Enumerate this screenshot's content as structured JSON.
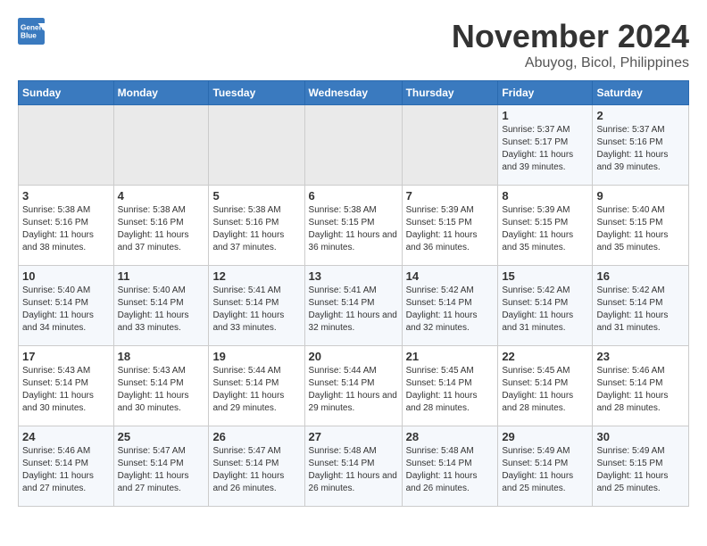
{
  "header": {
    "logo_line1": "General",
    "logo_line2": "Blue",
    "month": "November 2024",
    "location": "Abuyog, Bicol, Philippines"
  },
  "weekdays": [
    "Sunday",
    "Monday",
    "Tuesday",
    "Wednesday",
    "Thursday",
    "Friday",
    "Saturday"
  ],
  "weeks": [
    [
      {
        "day": "",
        "info": ""
      },
      {
        "day": "",
        "info": ""
      },
      {
        "day": "",
        "info": ""
      },
      {
        "day": "",
        "info": ""
      },
      {
        "day": "",
        "info": ""
      },
      {
        "day": "1",
        "info": "Sunrise: 5:37 AM\nSunset: 5:17 PM\nDaylight: 11 hours and 39 minutes."
      },
      {
        "day": "2",
        "info": "Sunrise: 5:37 AM\nSunset: 5:16 PM\nDaylight: 11 hours and 39 minutes."
      }
    ],
    [
      {
        "day": "3",
        "info": "Sunrise: 5:38 AM\nSunset: 5:16 PM\nDaylight: 11 hours and 38 minutes."
      },
      {
        "day": "4",
        "info": "Sunrise: 5:38 AM\nSunset: 5:16 PM\nDaylight: 11 hours and 37 minutes."
      },
      {
        "day": "5",
        "info": "Sunrise: 5:38 AM\nSunset: 5:16 PM\nDaylight: 11 hours and 37 minutes."
      },
      {
        "day": "6",
        "info": "Sunrise: 5:38 AM\nSunset: 5:15 PM\nDaylight: 11 hours and 36 minutes."
      },
      {
        "day": "7",
        "info": "Sunrise: 5:39 AM\nSunset: 5:15 PM\nDaylight: 11 hours and 36 minutes."
      },
      {
        "day": "8",
        "info": "Sunrise: 5:39 AM\nSunset: 5:15 PM\nDaylight: 11 hours and 35 minutes."
      },
      {
        "day": "9",
        "info": "Sunrise: 5:40 AM\nSunset: 5:15 PM\nDaylight: 11 hours and 35 minutes."
      }
    ],
    [
      {
        "day": "10",
        "info": "Sunrise: 5:40 AM\nSunset: 5:14 PM\nDaylight: 11 hours and 34 minutes."
      },
      {
        "day": "11",
        "info": "Sunrise: 5:40 AM\nSunset: 5:14 PM\nDaylight: 11 hours and 33 minutes."
      },
      {
        "day": "12",
        "info": "Sunrise: 5:41 AM\nSunset: 5:14 PM\nDaylight: 11 hours and 33 minutes."
      },
      {
        "day": "13",
        "info": "Sunrise: 5:41 AM\nSunset: 5:14 PM\nDaylight: 11 hours and 32 minutes."
      },
      {
        "day": "14",
        "info": "Sunrise: 5:42 AM\nSunset: 5:14 PM\nDaylight: 11 hours and 32 minutes."
      },
      {
        "day": "15",
        "info": "Sunrise: 5:42 AM\nSunset: 5:14 PM\nDaylight: 11 hours and 31 minutes."
      },
      {
        "day": "16",
        "info": "Sunrise: 5:42 AM\nSunset: 5:14 PM\nDaylight: 11 hours and 31 minutes."
      }
    ],
    [
      {
        "day": "17",
        "info": "Sunrise: 5:43 AM\nSunset: 5:14 PM\nDaylight: 11 hours and 30 minutes."
      },
      {
        "day": "18",
        "info": "Sunrise: 5:43 AM\nSunset: 5:14 PM\nDaylight: 11 hours and 30 minutes."
      },
      {
        "day": "19",
        "info": "Sunrise: 5:44 AM\nSunset: 5:14 PM\nDaylight: 11 hours and 29 minutes."
      },
      {
        "day": "20",
        "info": "Sunrise: 5:44 AM\nSunset: 5:14 PM\nDaylight: 11 hours and 29 minutes."
      },
      {
        "day": "21",
        "info": "Sunrise: 5:45 AM\nSunset: 5:14 PM\nDaylight: 11 hours and 28 minutes."
      },
      {
        "day": "22",
        "info": "Sunrise: 5:45 AM\nSunset: 5:14 PM\nDaylight: 11 hours and 28 minutes."
      },
      {
        "day": "23",
        "info": "Sunrise: 5:46 AM\nSunset: 5:14 PM\nDaylight: 11 hours and 28 minutes."
      }
    ],
    [
      {
        "day": "24",
        "info": "Sunrise: 5:46 AM\nSunset: 5:14 PM\nDaylight: 11 hours and 27 minutes."
      },
      {
        "day": "25",
        "info": "Sunrise: 5:47 AM\nSunset: 5:14 PM\nDaylight: 11 hours and 27 minutes."
      },
      {
        "day": "26",
        "info": "Sunrise: 5:47 AM\nSunset: 5:14 PM\nDaylight: 11 hours and 26 minutes."
      },
      {
        "day": "27",
        "info": "Sunrise: 5:48 AM\nSunset: 5:14 PM\nDaylight: 11 hours and 26 minutes."
      },
      {
        "day": "28",
        "info": "Sunrise: 5:48 AM\nSunset: 5:14 PM\nDaylight: 11 hours and 26 minutes."
      },
      {
        "day": "29",
        "info": "Sunrise: 5:49 AM\nSunset: 5:14 PM\nDaylight: 11 hours and 25 minutes."
      },
      {
        "day": "30",
        "info": "Sunrise: 5:49 AM\nSunset: 5:15 PM\nDaylight: 11 hours and 25 minutes."
      }
    ]
  ]
}
